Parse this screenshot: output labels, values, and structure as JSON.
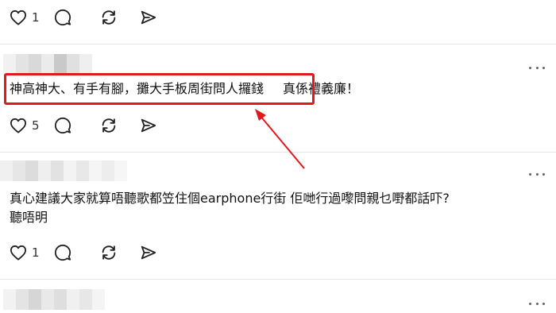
{
  "posts": [
    {
      "like_count": "1"
    },
    {
      "text_highlighted": "神高神大、有手有腳，攤大手板周街問人攞錢",
      "text_rest": "真係禮義廉！",
      "like_count": "5"
    },
    {
      "text_line1": "真心建議大家就算唔聽歌都笠住個earphone行街 佢哋行過嚟問親乜嘢都話吓?",
      "text_line2": "聽唔明",
      "like_count": "1"
    }
  ],
  "colors": {
    "highlight": "#e0191d",
    "icon": "#222222",
    "divider": "#e6e6e6"
  },
  "icons": [
    "heart-icon",
    "comment-icon",
    "repost-icon",
    "share-icon",
    "more-icon"
  ]
}
